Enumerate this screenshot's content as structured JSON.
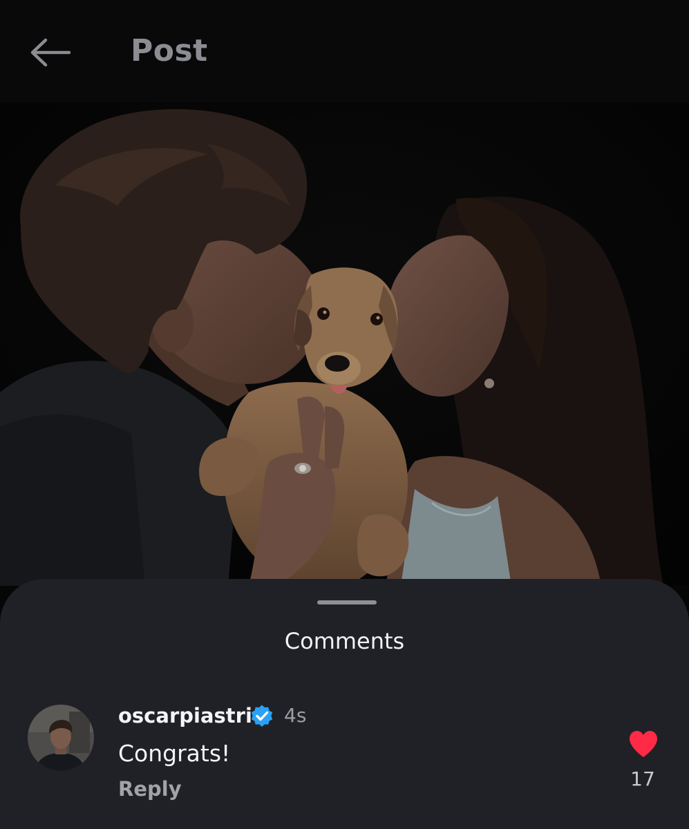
{
  "header": {
    "title": "Post",
    "back_icon": "arrow-left-icon"
  },
  "post": {
    "image_subject": "couple kissing a puppy",
    "image_name": "post-photo"
  },
  "comments_sheet": {
    "title": "Comments",
    "comments": [
      {
        "username": "oscarpiastri",
        "verified": true,
        "time_ago": "4s",
        "text": "Congrats!",
        "reply_label": "Reply",
        "likes": "17",
        "liked": true,
        "like_icon": "heart-icon"
      }
    ]
  },
  "colors": {
    "background": "#09090a",
    "sheet": "#202126",
    "like_red": "#ff2a46",
    "verified_blue": "#2aa1f6",
    "muted_text": "#9d9ea4"
  }
}
